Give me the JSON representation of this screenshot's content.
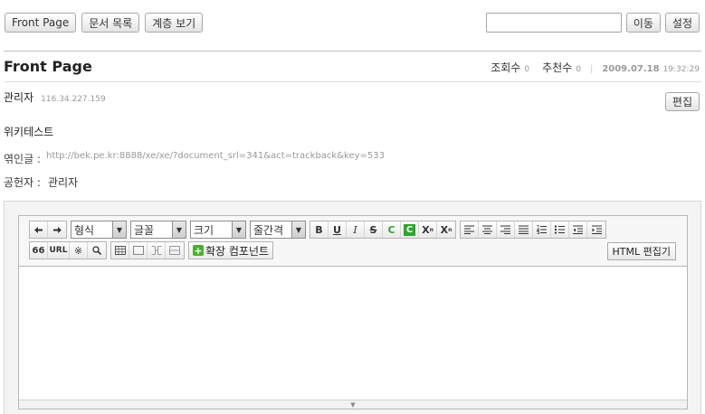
{
  "nav": {
    "front_page": "Front Page",
    "doc_list": "문서 목록",
    "hierarchy": "계층 보기"
  },
  "search": {
    "value": "",
    "placeholder": ""
  },
  "top_actions": {
    "go": "이동",
    "settings": "설정"
  },
  "document": {
    "title": "Front Page",
    "views_label": "조회수",
    "views": "0",
    "votes_label": "추천수",
    "votes": "0",
    "date": "2009.07.18",
    "time": "19:32:29",
    "author": "관리자",
    "ip": "116.34.227.159",
    "edit_label": "편집",
    "body": "위키테스트",
    "trackback_label": "엮인글 :",
    "trackback_url": "http://bek.pe.kr:8888/xe/xe/?document_srl=341&act=trackback&key=533",
    "contributors_label": "공헌자 :",
    "contributors": "관리자"
  },
  "editor": {
    "format_select": "형식",
    "font_select": "글꼴",
    "size_select": "크기",
    "line_spacing_select": "줄간격",
    "bold": "B",
    "underline": "U",
    "italic": "I",
    "strike": "S",
    "font_color": "C",
    "bg_color": "C",
    "superscript": "X",
    "subscript": "X",
    "quote": "66",
    "url": "URL",
    "special_char": "※",
    "find": "🔍",
    "extension_label": "확장 컴포넌트",
    "html_editor_label": "HTML 편집기",
    "colors": {
      "font_color": "#2fa52f",
      "bg_color": "#2fa52f",
      "plus": "#4caf2b"
    }
  }
}
